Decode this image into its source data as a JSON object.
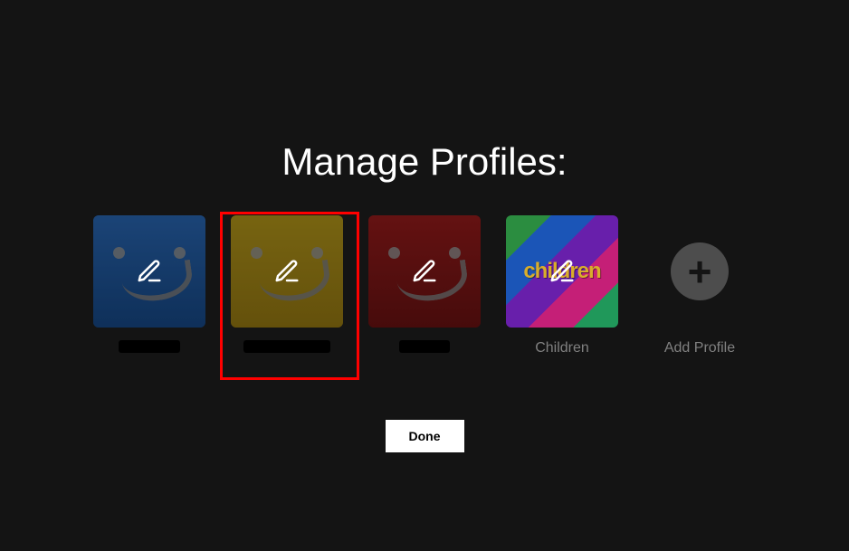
{
  "title": "Manage Profiles:",
  "profiles": [
    {
      "name": "",
      "kind": "blue"
    },
    {
      "name": "",
      "kind": "yellow",
      "highlighted": true
    },
    {
      "name": "",
      "kind": "red"
    },
    {
      "name": "Children",
      "kind": "children"
    }
  ],
  "add_profile_label": "Add Profile",
  "children_tile_text": "children",
  "done_label": "Done"
}
